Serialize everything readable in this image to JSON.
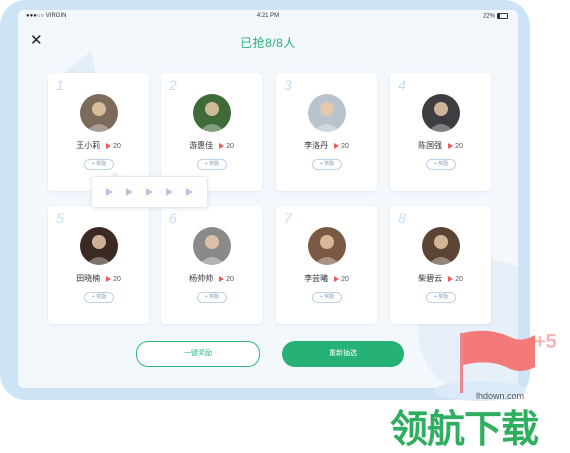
{
  "status_bar": {
    "carrier": "●●●○○ VIRGIN",
    "time": "4:21 PM",
    "battery": "22%"
  },
  "header": {
    "title": "已抢8/8人",
    "close_label": "✕"
  },
  "cards": [
    {
      "number": "1",
      "name": "王小莉",
      "count": "20",
      "reward_label": "+ 奖励",
      "avatar_color": "#7c6a5a"
    },
    {
      "number": "2",
      "name": "游惠佳",
      "count": "20",
      "reward_label": "+ 奖励",
      "avatar_color": "#3f6b3a"
    },
    {
      "number": "3",
      "name": "李洛丹",
      "count": "20",
      "reward_label": "+ 奖励",
      "avatar_color": "#b9c3cc"
    },
    {
      "number": "4",
      "name": "陈国强",
      "count": "20",
      "reward_label": "+ 奖励",
      "avatar_color": "#3d3d42"
    },
    {
      "number": "5",
      "name": "田晓楠",
      "count": "20",
      "reward_label": "+ 奖励",
      "avatar_color": "#3a2a22"
    },
    {
      "number": "6",
      "name": "杨帅帅",
      "count": "20",
      "reward_label": "+ 奖励",
      "avatar_color": "#8a8a8a"
    },
    {
      "number": "7",
      "name": "李芸曦",
      "count": "20",
      "reward_label": "+ 奖励",
      "avatar_color": "#7a5a44"
    },
    {
      "number": "8",
      "name": "柴碧云",
      "count": "20",
      "reward_label": "+ 奖励",
      "avatar_color": "#5b4434"
    }
  ],
  "popup": {
    "flag_count": 5
  },
  "buttons": {
    "one_click_reward": "一键奖励",
    "redraw": "重新抽选"
  },
  "watermark": {
    "plus": "+5",
    "url": "lhdown.com",
    "brand": "领航下载"
  },
  "colors": {
    "accent": "#26b276",
    "flag": "#f05a5a"
  }
}
